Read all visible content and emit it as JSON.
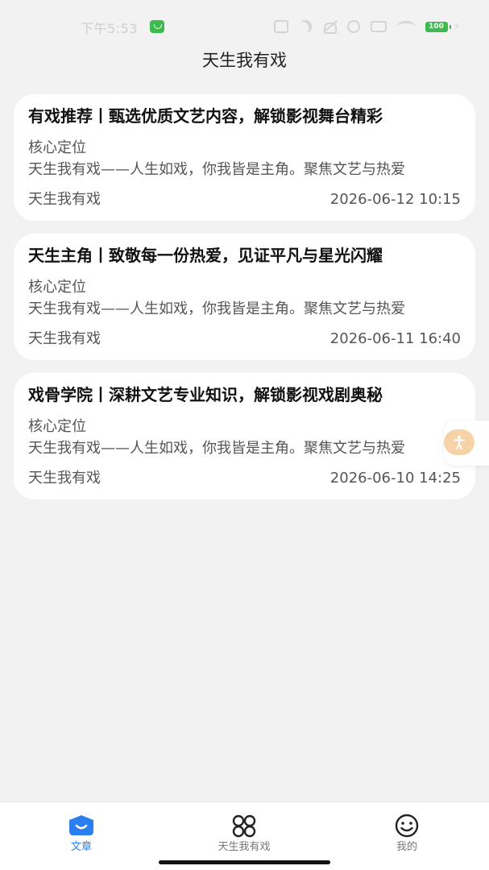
{
  "status_bar": {
    "time": "下午5:53",
    "battery": "100"
  },
  "header": {
    "title": "天生我有戏"
  },
  "articles": [
    {
      "title": "有戏推荐丨甄选优质文艺内容，解锁影视舞台精彩",
      "subheading": "核心定位",
      "excerpt": "天生我有戏——人生如戏，你我皆是主角。聚焦文艺与热爱",
      "author": "天生我有戏",
      "date": "2026-06-12 10:15"
    },
    {
      "title": "天生主角丨致敬每一份热爱，见证平凡与星光闪耀",
      "subheading": "核心定位",
      "excerpt": "天生我有戏——人生如戏，你我皆是主角。聚焦文艺与热爱",
      "author": "天生我有戏",
      "date": "2026-06-11 16:40"
    },
    {
      "title": "戏骨学院丨深耕文艺专业知识，解锁影视戏剧奥秘",
      "subheading": "核心定位",
      "excerpt": "天生我有戏——人生如戏，你我皆是主角。聚焦文艺与热爱",
      "author": "天生我有戏",
      "date": "2026-06-10 14:25"
    }
  ],
  "bottom_nav": {
    "items": [
      {
        "label": "文章",
        "icon": "article-icon",
        "active": true
      },
      {
        "label": "天生我有戏",
        "icon": "grid-icon",
        "active": false
      },
      {
        "label": "我的",
        "icon": "smiley-icon",
        "active": false
      }
    ]
  },
  "colors": {
    "accent": "#2b7ef0",
    "background": "#f2f2f2",
    "card": "#ffffff",
    "float_button": "#f6d3a6"
  }
}
